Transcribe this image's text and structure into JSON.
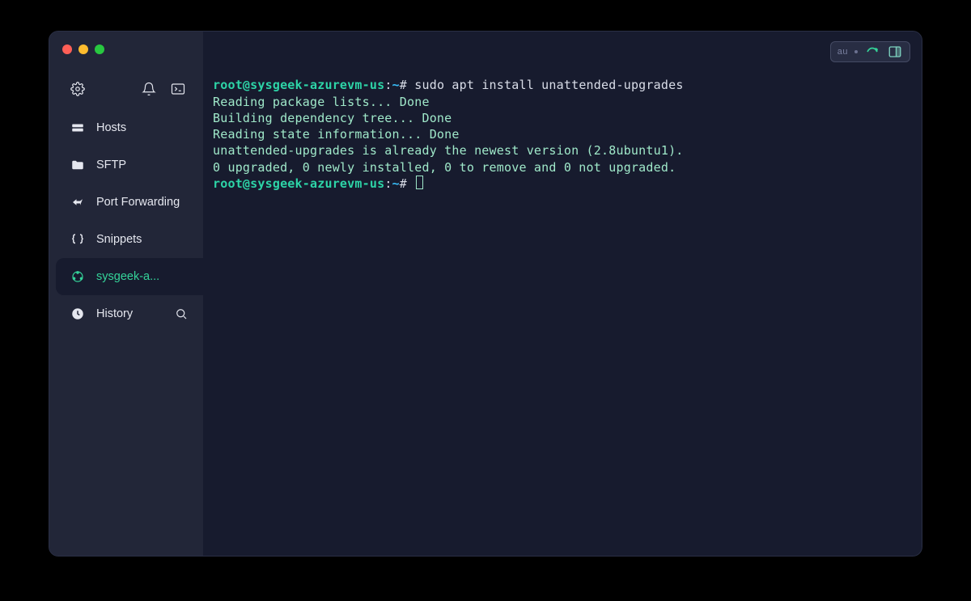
{
  "sidebar": {
    "items": [
      {
        "label": "Hosts"
      },
      {
        "label": "SFTP"
      },
      {
        "label": "Port Forwarding"
      },
      {
        "label": "Snippets"
      },
      {
        "label": "sysgeek-a..."
      },
      {
        "label": "History"
      }
    ]
  },
  "toolbar": {
    "mode_label": "au"
  },
  "terminal": {
    "prompt_user_host": "root@sysgeek-azurevm-us",
    "prompt_sep": ":",
    "prompt_path": "~",
    "prompt_symbol": "#",
    "lines": [
      {
        "command": "sudo apt install unattended-upgrades"
      },
      {
        "output": "Reading package lists... Done"
      },
      {
        "output": "Building dependency tree... Done"
      },
      {
        "output": "Reading state information... Done"
      },
      {
        "output": "unattended-upgrades is already the newest version (2.8ubuntu1)."
      },
      {
        "output": "0 upgraded, 0 newly installed, 0 to remove and 0 not upgraded."
      }
    ]
  }
}
